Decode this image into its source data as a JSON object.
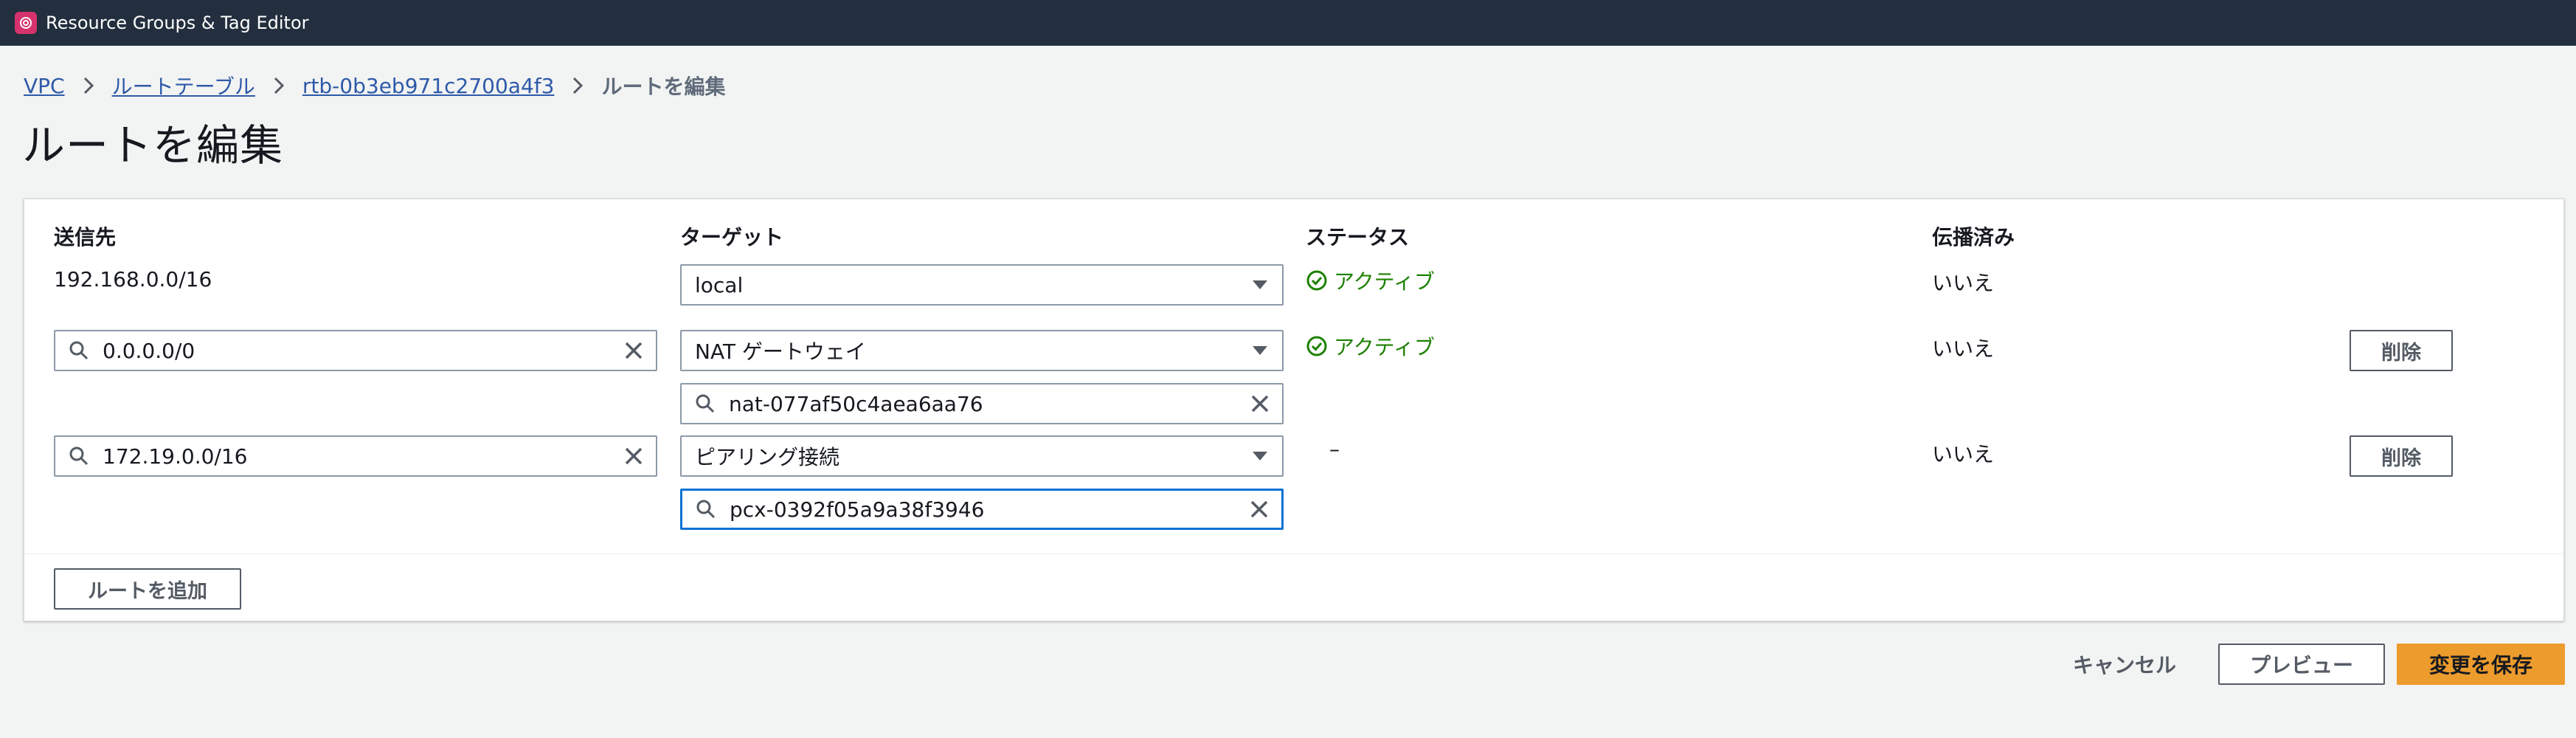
{
  "app": {
    "title": "Resource Groups & Tag Editor",
    "icon": "resource-groups-icon"
  },
  "breadcrumb": {
    "items": [
      "VPC",
      "ルートテーブル",
      "rtb-0b3eb971c2700a4f3"
    ],
    "current": "ルートを編集"
  },
  "page": {
    "title": "ルートを編集"
  },
  "table": {
    "headers": {
      "destination": "送信先",
      "target": "ターゲット",
      "status": "ステータス",
      "propagated": "伝播済み"
    },
    "rows": [
      {
        "destination": "192.168.0.0/16",
        "target_type": "local",
        "target_id": "",
        "status": "アクティブ",
        "propagated": "いいえ",
        "remove": ""
      },
      {
        "destination": "0.0.0.0/0",
        "target_type": "NAT ゲートウェイ",
        "target_id": "nat-077af50c4aea6aa76",
        "status": "アクティブ",
        "propagated": "いいえ",
        "remove": "削除"
      },
      {
        "destination": "172.19.0.0/16",
        "target_type": "ピアリング接続",
        "target_id": "pcx-0392f05a9a38f3946",
        "status": "–",
        "propagated": "いいえ",
        "remove": "削除"
      }
    ]
  },
  "actions": {
    "add_route": "ルートを追加"
  },
  "footer": {
    "cancel": "キャンセル",
    "preview": "プレビュー",
    "save": "変更を保存"
  },
  "colors": {
    "topbar": "#232f3e",
    "accent": "#ec9b2d",
    "status_active": "#1d8102",
    "link": "#2e5aa8"
  }
}
